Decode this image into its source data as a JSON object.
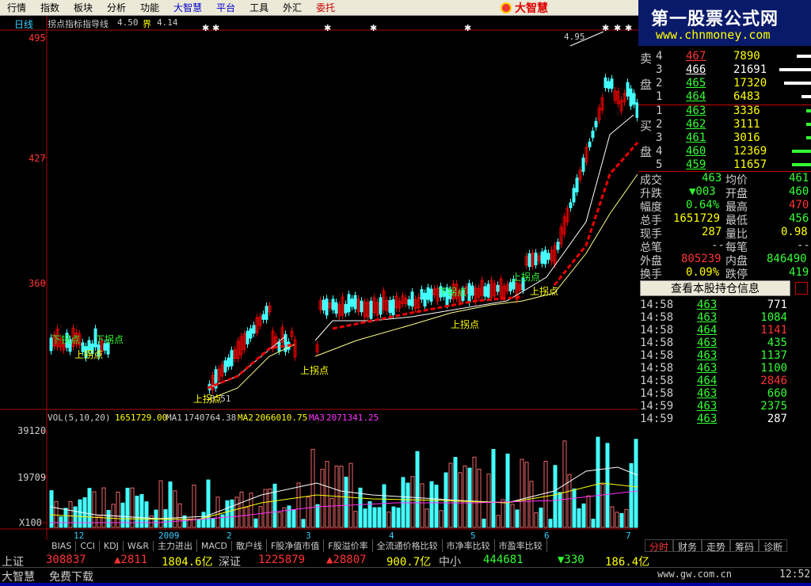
{
  "menu": [
    "行情",
    "指数",
    "板块",
    "分析",
    "功能",
    "大智慧",
    "平台",
    "工具",
    "外汇",
    "委托"
  ],
  "logo": "大智慧",
  "watermark": {
    "title": "第一股票公式网",
    "url": "www.chnmoney.com"
  },
  "main_chart": {
    "period_label": "日线",
    "indicator_title": "拐点指标指导线",
    "indicator_v1": "4.50",
    "indicator_v2_label": "界",
    "indicator_v2": "4.14",
    "price_axis": [
      "495",
      "427",
      "360"
    ],
    "peak_label": "4.95",
    "trough_label": "3.51",
    "turn_labels": [
      "上拐点",
      "下拐点",
      "上拐点",
      "上拐点",
      "上拐点",
      "下拐点",
      "上拐点",
      "下拐点",
      "上拐点",
      "上拐点"
    ]
  },
  "vol_chart": {
    "title": "VOL(5,10,20)",
    "vol": "1651729.00",
    "ma1_label": "MA1",
    "ma1": "1740764.38",
    "ma2_label": "MA2",
    "ma2": "2066010.75",
    "ma3_label": "MA3",
    "ma3": "2071341.25",
    "axis": [
      "39120",
      "19709",
      "X100"
    ],
    "x_ticks": [
      "12",
      "2009",
      "2",
      "3",
      "4",
      "5",
      "6",
      "7"
    ]
  },
  "tabs": [
    "BIAS",
    "CCI",
    "KDJ",
    "W&R",
    "主力进出",
    "MACD",
    "散户线",
    "F股净值市值",
    "F股溢价率",
    "全流通价格比较",
    "市净率比较",
    "市盈率比较"
  ],
  "right_tabs": [
    "分时",
    "财务",
    "走势",
    "筹码",
    "诊断"
  ],
  "orderbook": {
    "sell_label_1": "卖",
    "sell_label_2": "盘",
    "buy_label_1": "买",
    "buy_label_2": "盘",
    "sell": [
      {
        "n": "4",
        "p": "467",
        "v": "7890"
      },
      {
        "n": "3",
        "p": "466",
        "v": "21691"
      },
      {
        "n": "2",
        "p": "465",
        "v": "17320"
      },
      {
        "n": "1",
        "p": "464",
        "v": "6483"
      }
    ],
    "buy": [
      {
        "n": "1",
        "p": "463",
        "v": "3336"
      },
      {
        "n": "2",
        "p": "462",
        "v": "3111"
      },
      {
        "n": "3",
        "p": "461",
        "v": "3016"
      },
      {
        "n": "4",
        "p": "460",
        "v": "12369"
      },
      {
        "n": "5",
        "p": "459",
        "v": "11657"
      }
    ]
  },
  "stats": [
    {
      "l": "成交",
      "v": "463",
      "l2": "均价",
      "v2": "461"
    },
    {
      "l": "升跌",
      "v": "▼003",
      "l2": "开盘",
      "v2": "460"
    },
    {
      "l": "幅度",
      "v": "0.64%",
      "l2": "最高",
      "v2": "470"
    },
    {
      "l": "总手",
      "v": "1651729",
      "l2": "最低",
      "v2": "456"
    },
    {
      "l": "现手",
      "v": "287",
      "l2": "量比",
      "v2": "0.98"
    },
    {
      "l": "总笔",
      "v": "--",
      "l2": "每笔",
      "v2": "--"
    },
    {
      "l": "外盘",
      "v": "805239",
      "l2": "内盘",
      "v2": "846490"
    },
    {
      "l": "换手",
      "v": "0.09%",
      "l2": "跌停",
      "v2": "419"
    }
  ],
  "position_button": "查看本股持仓信息",
  "ticks": [
    {
      "t": "14:58",
      "p": "463",
      "v": "771",
      "c": "#fff"
    },
    {
      "t": "14:58",
      "p": "463",
      "v": "1084",
      "c": "#3f3"
    },
    {
      "t": "14:58",
      "p": "464",
      "v": "1141",
      "c": "#f33"
    },
    {
      "t": "14:58",
      "p": "463",
      "v": "435",
      "c": "#3f3"
    },
    {
      "t": "14:58",
      "p": "463",
      "v": "1137",
      "c": "#3f3"
    },
    {
      "t": "14:58",
      "p": "463",
      "v": "1100",
      "c": "#3f3"
    },
    {
      "t": "14:58",
      "p": "464",
      "v": "2846",
      "c": "#f33"
    },
    {
      "t": "14:58",
      "p": "463",
      "v": "660",
      "c": "#3f3"
    },
    {
      "t": "14:59",
      "p": "463",
      "v": "2375",
      "c": "#3f3"
    },
    {
      "t": "14:59",
      "p": "463",
      "v": "287",
      "c": "#fff"
    }
  ],
  "status": {
    "sh_label": "上证",
    "sh_vol": "308837",
    "sh_chg": "▲2811",
    "sh_amt": "1804.6亿",
    "sz_label": "深证",
    "sz_vol": "1225879",
    "sz_chg": "▲28807",
    "sz_amt": "900.7亿",
    "zx_label": "中小",
    "zx_vol": "444681",
    "zx_chg": "▼330",
    "zx_amt": "186.4亿"
  },
  "footer": {
    "brand": "大智慧",
    "free": "免费下载",
    "url": "www.gw.com.cn",
    "time": "12:52"
  }
}
